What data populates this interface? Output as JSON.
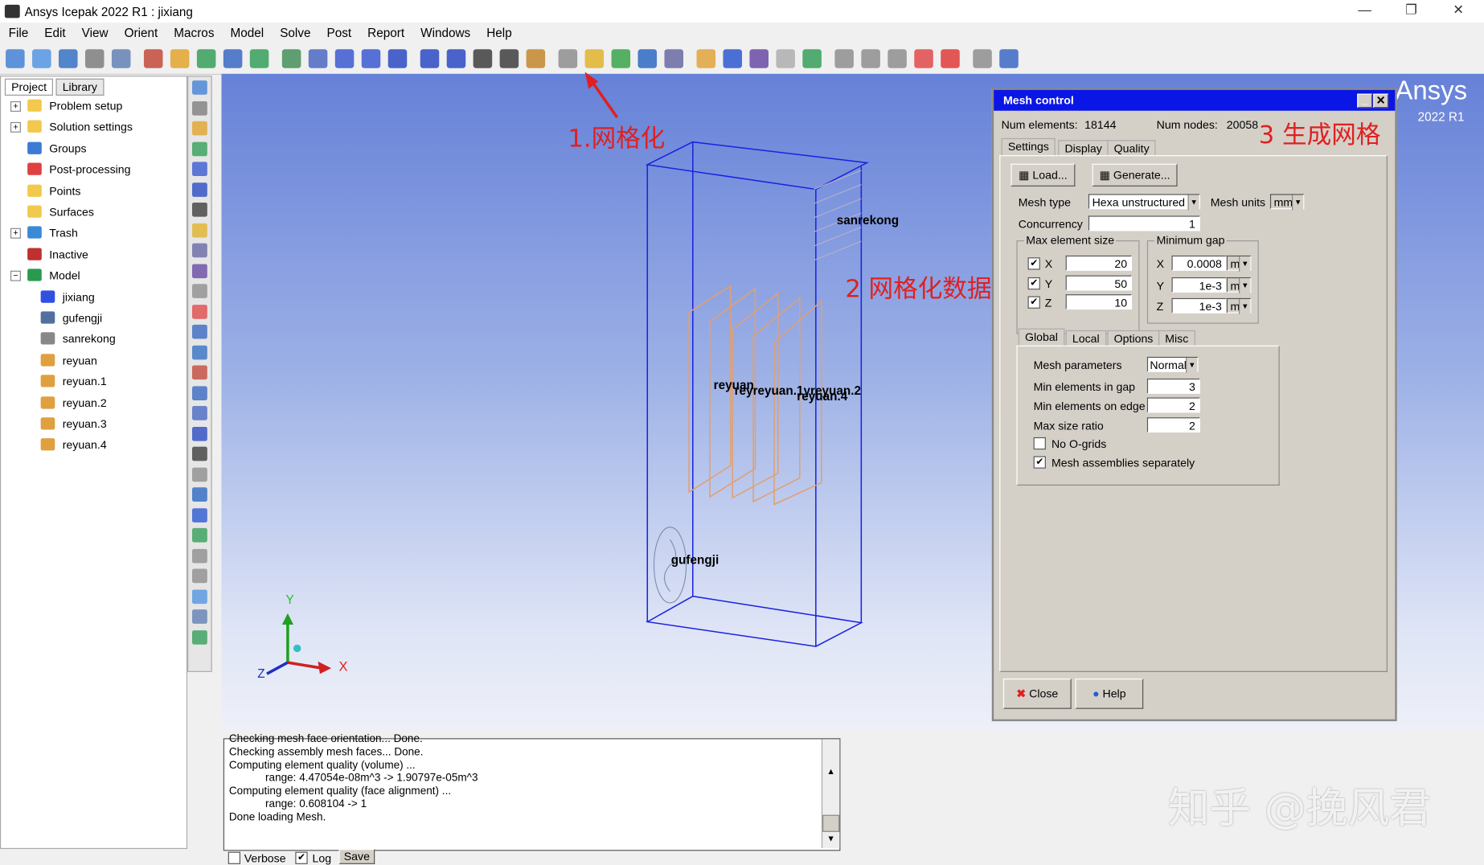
{
  "window": {
    "title": "Ansys Icepak 2022 R1 : jixiang",
    "minimize": "—",
    "restore": "❐",
    "close": "✕"
  },
  "menu": [
    "File",
    "Edit",
    "View",
    "Orient",
    "Macros",
    "Model",
    "Solve",
    "Post",
    "Report",
    "Windows",
    "Help"
  ],
  "left_panel": {
    "tabs": [
      "Project",
      "Library"
    ],
    "tree": [
      {
        "label": "Problem setup",
        "icon": "folder-icon",
        "level": 0,
        "exp": "+"
      },
      {
        "label": "Solution settings",
        "icon": "folder-icon",
        "level": 0,
        "exp": "+"
      },
      {
        "label": "Groups",
        "icon": "groups-icon",
        "level": 0,
        "exp": ""
      },
      {
        "label": "Post-processing",
        "icon": "post-processing-icon",
        "level": 0,
        "exp": ""
      },
      {
        "label": "Points",
        "icon": "folder-icon",
        "level": 0,
        "exp": ""
      },
      {
        "label": "Surfaces",
        "icon": "folder-icon",
        "level": 0,
        "exp": ""
      },
      {
        "label": "Trash",
        "icon": "trash-icon",
        "level": 0,
        "exp": "+"
      },
      {
        "label": "Inactive",
        "icon": "inactive-icon",
        "level": 0,
        "exp": ""
      },
      {
        "label": "Model",
        "icon": "model-icon",
        "level": 0,
        "exp": "−"
      },
      {
        "label": "jixiang",
        "icon": "cabinet-icon",
        "level": 1,
        "exp": ""
      },
      {
        "label": "gufengji",
        "icon": "fan-icon",
        "level": 1,
        "exp": ""
      },
      {
        "label": "sanrekong",
        "icon": "grille-icon",
        "level": 1,
        "exp": ""
      },
      {
        "label": "reyuan",
        "icon": "source-icon",
        "level": 1,
        "exp": ""
      },
      {
        "label": "reyuan.1",
        "icon": "source-icon",
        "level": 1,
        "exp": ""
      },
      {
        "label": "reyuan.2",
        "icon": "source-icon",
        "level": 1,
        "exp": ""
      },
      {
        "label": "reyuan.3",
        "icon": "source-icon",
        "level": 1,
        "exp": ""
      },
      {
        "label": "reyuan.4",
        "icon": "source-icon",
        "level": 1,
        "exp": ""
      }
    ]
  },
  "viewport": {
    "labels": {
      "sanrekong": "sanrekong",
      "reyuan": "reyuan",
      "reyuan_overlap": "reyreyuan.1yreyuan.2",
      "reyuan4": "reyuan.4",
      "gufengji": "gufengji"
    },
    "axes": {
      "x": "X",
      "y": "Y",
      "z": "Z"
    },
    "brand": "Ansys",
    "version": "2022 R1"
  },
  "annotations": {
    "step1": "1.网格化",
    "step2": "2 网格化数据",
    "step3": "3 生成网格",
    "color": "#e02020"
  },
  "mesh_control": {
    "title": "Mesh control",
    "num_elements_label": "Num elements:",
    "num_elements": "18144",
    "num_nodes_label": "Num nodes:",
    "num_nodes": "20058",
    "tabs": [
      "Settings",
      "Display",
      "Quality"
    ],
    "load": "Load...",
    "generate": "Generate...",
    "mesh_type_label": "Mesh type",
    "mesh_type": "Hexa unstructured",
    "mesh_units_label": "Mesh units",
    "mesh_units": "mm",
    "concurrency_label": "Concurrency",
    "concurrency": "1",
    "max_size_label": "Max element size",
    "max_size": [
      {
        "axis": "X",
        "value": "20",
        "checked": true
      },
      {
        "axis": "Y",
        "value": "50",
        "checked": true
      },
      {
        "axis": "Z",
        "value": "10",
        "checked": true
      }
    ],
    "min_gap_label": "Minimum gap",
    "min_gap": [
      {
        "axis": "X",
        "value": "0.0008",
        "unit": "m"
      },
      {
        "axis": "Y",
        "value": "1e-3",
        "unit": "m"
      },
      {
        "axis": "Z",
        "value": "1e-3",
        "unit": "m"
      }
    ],
    "subtabs": [
      "Global",
      "Local",
      "Options",
      "Misc"
    ],
    "mesh_params_label": "Mesh parameters",
    "mesh_params": "Normal",
    "min_gap_elems_label": "Min elements in gap",
    "min_gap_elems": "3",
    "min_edge_elems_label": "Min elements on edge",
    "min_edge_elems": "2",
    "max_ratio_label": "Max size ratio",
    "max_ratio": "2",
    "no_ogrids_label": "No O-grids",
    "no_ogrids": false,
    "separate_label": "Mesh assemblies separately",
    "separate": true,
    "close": "Close",
    "help": "Help"
  },
  "log": {
    "lines": [
      "Checking mesh face orientation... Done.",
      "Checking assembly mesh faces... Done.",
      "Computing element quality (volume) ...",
      "            range: 4.47054e-08m^3 -> 1.90797e-05m^3",
      "Computing element quality (face alignment) ...",
      "            range: 0.608104 -> 1",
      "Done loading Mesh."
    ],
    "verbose": "Verbose",
    "log": "Log",
    "save": "Save"
  },
  "watermark": "知乎 @挽风君"
}
